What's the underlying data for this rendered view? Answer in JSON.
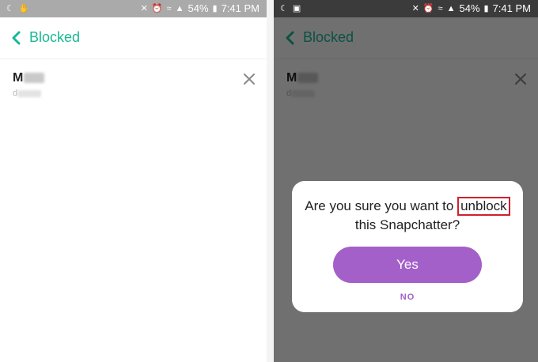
{
  "status_bar": {
    "battery": "54%",
    "time": "7:41 PM",
    "icons": [
      "moon-icon",
      "hand-icon",
      "mute-icon",
      "alarm-icon",
      "wifi-icon",
      "signal-icon",
      "battery-icon"
    ]
  },
  "screen": {
    "back_icon": "chevron-left-icon",
    "title": "Blocked",
    "accent_color": "#19b896"
  },
  "blocked_user": {
    "name_prefix": "M",
    "username_prefix": "d",
    "remove_icon": "close-icon"
  },
  "dialog": {
    "message_prefix": "Are you sure you want to",
    "highlighted_word": "unblock",
    "message_suffix": "this Snapchatter?",
    "yes_label": "Yes",
    "no_label": "NO",
    "button_color": "#a360c9",
    "highlight_border_color": "#d0202c"
  }
}
